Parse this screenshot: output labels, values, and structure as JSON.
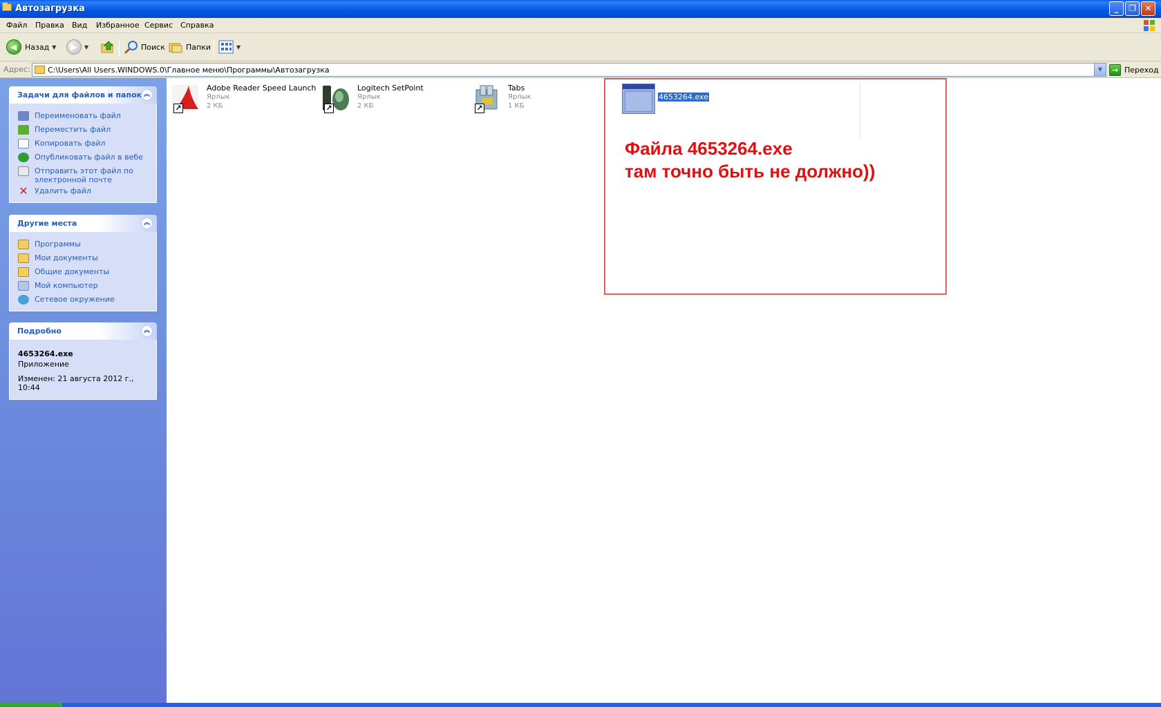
{
  "window": {
    "title": "Автозагрузка"
  },
  "menu": [
    "Файл",
    "Правка",
    "Вид",
    "Избранное",
    "Сервис",
    "Справка"
  ],
  "toolbar": {
    "back": "Назад",
    "search": "Поиск",
    "folders": "Папки"
  },
  "address": {
    "label": "Адрес:",
    "path": "C:\\Users\\All Users.WINDOWS.0\\Главное меню\\Программы\\Автозагрузка",
    "go": "Переход"
  },
  "tasks": {
    "title": "Задачи для файлов и папок",
    "items": [
      "Переименовать файл",
      "Переместить файл",
      "Копировать файл",
      "Опубликовать файл в вебе",
      "Отправить этот файл по электронной почте",
      "Удалить файл"
    ]
  },
  "places": {
    "title": "Другие места",
    "items": [
      "Программы",
      "Мои документы",
      "Общие документы",
      "Мой компьютер",
      "Сетевое окружение"
    ]
  },
  "details": {
    "title": "Подробно",
    "name": "4653264.exe",
    "type": "Приложение",
    "modified": "Изменен: 21 августа 2012 г., 10:44"
  },
  "files": [
    {
      "name": "Adobe Reader Speed Launch",
      "type": "Ярлык",
      "size": "2 КБ"
    },
    {
      "name": "Logitech SetPoint",
      "type": "Ярлык",
      "size": "2 КБ"
    },
    {
      "name": "Tabs",
      "type": "Ярлык",
      "size": "1 КБ"
    },
    {
      "name": "4653264.exe"
    }
  ],
  "annotation": {
    "line1": "Файла 4653264.exe",
    "line2": "там точно быть не должно))"
  },
  "colors": {
    "annotation_red": "#e01010",
    "selection_blue": "#316ac5",
    "task_link": "#215dc6"
  }
}
